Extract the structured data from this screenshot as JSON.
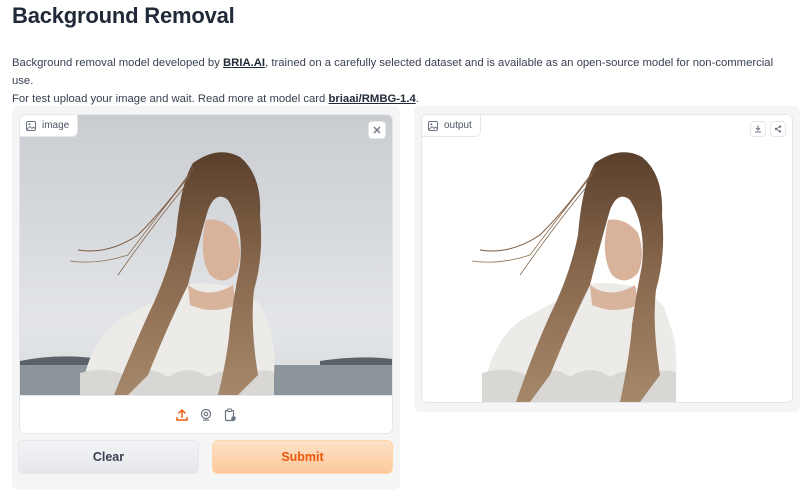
{
  "page": {
    "title": "Background Removal"
  },
  "description": {
    "line1_prefix": "Background removal model developed by ",
    "line1_link": "BRIA.AI",
    "line1_suffix": ", trained on a carefully selected dataset and is available as an open-source model for non-commercial use.",
    "line2_prefix": "For test upload your image and wait. Read more at model card ",
    "line2_link": "briaai/RMBG-1.4",
    "line2_suffix": "."
  },
  "input_panel": {
    "label": "image",
    "label_icon": "image-icon",
    "close_icon": "close-icon",
    "sources": [
      "upload-icon",
      "webcam-icon",
      "clipboard-icon"
    ]
  },
  "output_panel": {
    "label": "output",
    "label_icon": "image-icon",
    "actions": [
      "download-icon",
      "share-icon"
    ]
  },
  "buttons": {
    "clear_label": "Clear",
    "submit_label": "Submit"
  },
  "colors": {
    "accent": "#ea580c",
    "submit_bg": "#fdc89a",
    "clear_bg": "#e5e7eb"
  }
}
